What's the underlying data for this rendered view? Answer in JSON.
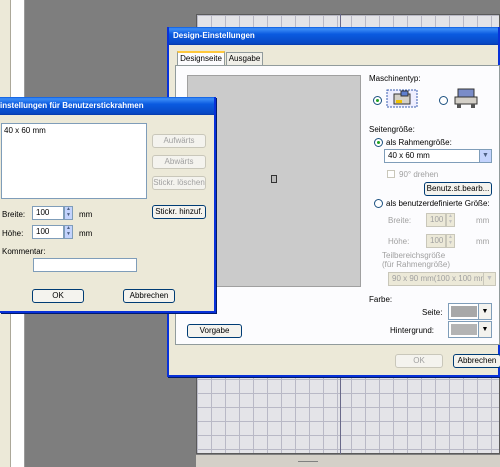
{
  "design_dialog": {
    "title": "Design-Einstellungen",
    "tabs": [
      "Designseite",
      "Ausgabe"
    ],
    "machine_type_label": "Maschinentyp:",
    "page_size_label": "Seitengröße:",
    "frame_size_radio": "als Rahmengröße:",
    "frame_size_value": "40 x 60 mm",
    "rotate_label": "90° drehen",
    "user_frame_button": "Benutz.st.bearb...",
    "custom_size_radio": "als benutzerdefinierte Größe:",
    "width_label": "Breite:",
    "width_value": "100",
    "height_label": "Höhe:",
    "height_value": "100",
    "unit": "mm",
    "sub_area_label_1": "Teilbereichsgröße",
    "sub_area_label_2": "(für Rahmengröße)",
    "sub_area_value": "90 x 90 mm(100 x 100 mm)",
    "color_label": "Farbe:",
    "page_color_label": "Seite:",
    "background_color_label": "Hintergrund:",
    "default_button": "Vorgabe",
    "ok_button": "OK",
    "cancel_button": "Abbrechen"
  },
  "frame_dialog": {
    "title": "instellungen für Benutzerstickrahmen",
    "list_items": [
      "40 x 60 mm"
    ],
    "up_button": "Aufwärts",
    "down_button": "Abwärts",
    "delete_button": "Stickr. löschen",
    "add_button": "Stickr. hinzuf.",
    "width_label": "Breite:",
    "width_value": "100",
    "height_label": "Höhe:",
    "height_value": "100",
    "unit": "mm",
    "comment_label": "Kommentar:",
    "comment_value": "",
    "ok_button": "OK",
    "cancel_button": "Abbrechen"
  },
  "colors": {
    "title_bar": "#0a5ae0",
    "page_color": "#a8a8a8",
    "background_color": "#b4b4b4",
    "preview_area": "#cbcbcb"
  }
}
